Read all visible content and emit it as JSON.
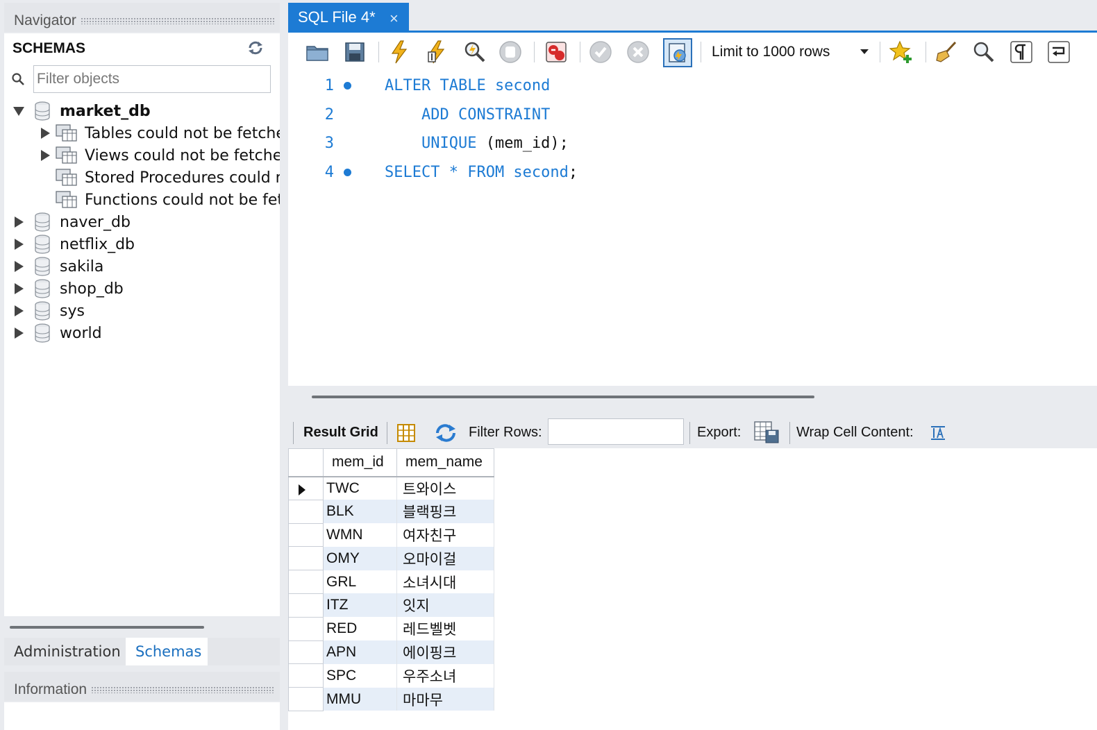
{
  "navigator": {
    "title": "Navigator",
    "schemas_title": "SCHEMAS",
    "filter_placeholder": "Filter objects",
    "expanded_db": {
      "name": "market_db",
      "children": [
        "Tables could not be fetched",
        "Views could not be fetched",
        "Stored Procedures could not be fetched",
        "Functions could not be fetched"
      ]
    },
    "other_dbs": [
      "naver_db",
      "netflix_db",
      "sakila",
      "shop_db",
      "sys",
      "world"
    ],
    "bottom_tabs": [
      "Administration",
      "Schemas"
    ],
    "active_bottom_tab": "Schemas",
    "information_title": "Information"
  },
  "editor": {
    "tab_label": "SQL File 4*",
    "tab_close": "×",
    "limit_label": "Limit to 1000 rows",
    "toolbar_icons": [
      "open-folder-icon",
      "save-icon",
      "execute-icon",
      "execute-current-icon",
      "explain-icon",
      "stop-icon",
      "stop-on-error-icon",
      "commit-icon",
      "rollback-icon",
      "autocommit-icon",
      "limit-dropdown",
      "add-snippet-icon",
      "beautify-icon",
      "find-icon",
      "invisible-chars-icon",
      "wrap-icon"
    ],
    "lines": [
      {
        "num": "1",
        "breakpoint": true,
        "indent": "",
        "keyword": "ALTER TABLE second",
        "rest": ""
      },
      {
        "num": "2",
        "breakpoint": false,
        "indent": "    ",
        "keyword": "ADD CONSTRAINT",
        "rest": ""
      },
      {
        "num": "3",
        "breakpoint": false,
        "indent": "    ",
        "keyword": "UNIQUE",
        "rest": " (mem_id);"
      },
      {
        "num": "4",
        "breakpoint": true,
        "indent": "",
        "keyword": "SELECT * FROM second",
        "rest": ";"
      }
    ]
  },
  "result": {
    "result_grid_label": "Result Grid",
    "filter_rows_label": "Filter Rows:",
    "export_label": "Export:",
    "wrap_label": "Wrap Cell Content:",
    "columns": [
      "mem_id",
      "mem_name"
    ],
    "rows": [
      [
        "TWC",
        "트와이스"
      ],
      [
        "BLK",
        "블랙핑크"
      ],
      [
        "WMN",
        "여자친구"
      ],
      [
        "OMY",
        "오마이걸"
      ],
      [
        "GRL",
        "소녀시대"
      ],
      [
        "ITZ",
        "잇지"
      ],
      [
        "RED",
        "레드벨벳"
      ],
      [
        "APN",
        "에이핑크"
      ],
      [
        "SPC",
        "우주소녀"
      ],
      [
        "MMU",
        "마마무"
      ]
    ]
  },
  "colors": {
    "accent": "#1d7bd4",
    "alt_row": "#e6eef8"
  }
}
